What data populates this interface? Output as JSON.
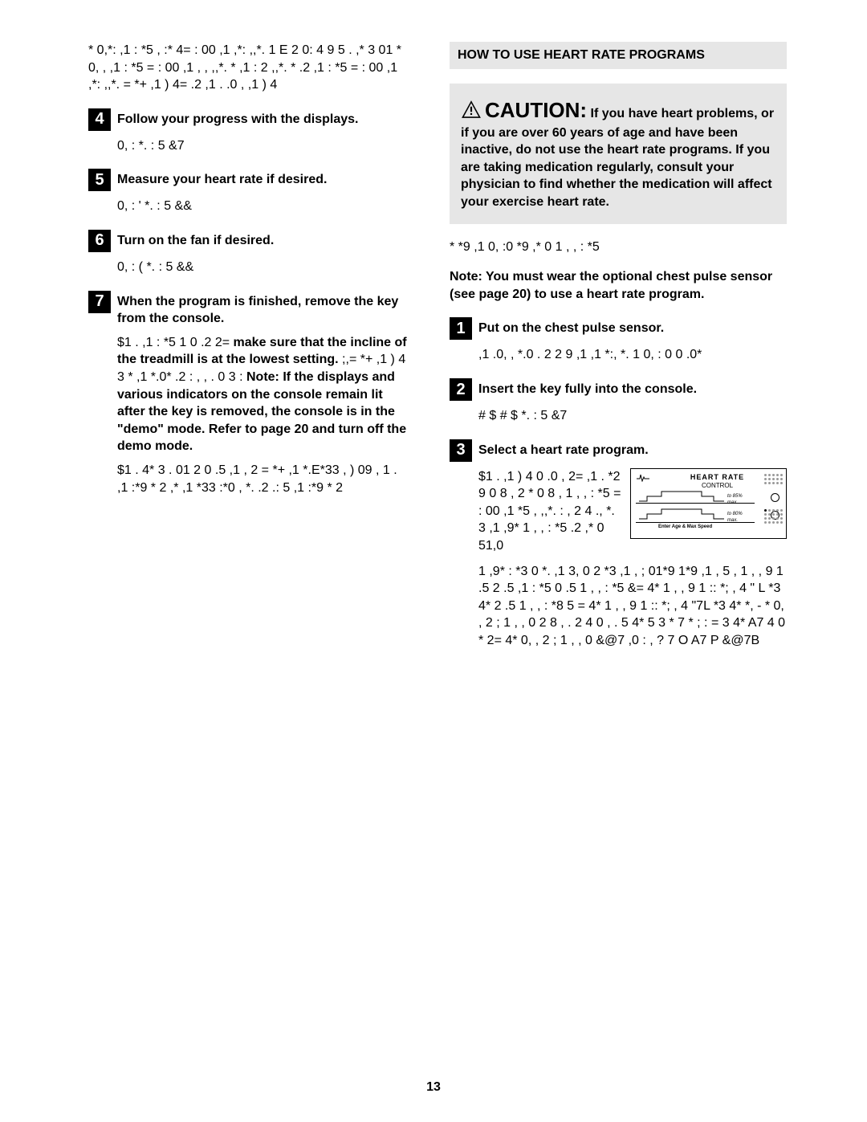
{
  "left": {
    "intro_para": "* 0,*: ,1  : *5    ,  :*    4= :  00 ,1   ,*:  ,,*.   1     E    2 0:  4 9     5 . ,* 3  01 *  0,  , ,1  : *5   = :  00 ,1   ,  ,                 ,,*.  * ,1   :  2         ,,*.  *  .2 ,1  : *5   = :  00 ,1   ,*:  ,,*. =   *+ ,1  ) 4=  .2 ,1 .   .0  , ,1  ) 4",
    "step4_title": "Follow your progress with the displays.",
    "step4_body": "0, :   *. : 5  &7",
    "step5_title": "Measure your heart rate if desired.",
    "step5_body": "0, : ' *. : 5  &&",
    "step6_title": "Turn on the fan if desired.",
    "step6_body": "0, : ( *. : 5  &&",
    "step7_title": "When the program is finished, remove the key from the console.",
    "step7_para1_a": "$1 . ,1  : *5   1 0  .2 2=          ",
    "step7_para1_b": "make sure that the incline of the treadmill is at the lowest setting.",
    "step7_para1_c": "  ;,=    *+  ,1  ) 4 3 *  ,1   *.0*   .2  :  ,   ,   .   0 3  :            ",
    "step7_para1_d": "Note: If the displays and various indicators on the console remain lit after the key is removed, the console is in the \"demo\" mode. Refer to page 20 and turn off the demo mode.",
    "step7_para2": "$1 . 4*    3 . 01 2  0 .5 ,1   ,  2   =  *+ ,1   *.E*33    ,    )  09 , 1 .   ,1  :*9  * 2 ,* ,1   *33 :*0 , *.  .2  .: 5 ,1  :*9   * 2"
  },
  "right": {
    "header": "HOW TO USE HEART RATE PROGRAMS",
    "caution_title": "CAUTION:",
    "caution_body": " If you have heart problems, or if you are over 60 years of age and have been inactive, do not use the heart rate programs. If you are taking medication regularly, consult your physician to find whether the medication will affect your exercise heart rate.",
    "pre_note": "*  *9  ,1  0, :0   *9  ,*  0   1   ,   ,  : *5",
    "note_bold": "Note: You must wear the optional chest pulse sensor (see page 20) to use a heart rate program.",
    "step1_title": "Put on the chest pulse sensor.",
    "step1_body": ",1   .0,   , *.0 .   2 2 9 ,1 ,1  *:, *. 1 0, :  0  0 .0*",
    "step2_title": "Insert the key fully into the console.",
    "step2_body": "   # $        #   $  *. : 5 &7",
    "step3_title": "Select a heart rate program.",
    "step3_body1": "$1 . ,1  ) 4 0  .0 , 2= ,1  .    *2 9      0 8 , 2   *  0 8 ,  1   , ,  : *5   = :  00 ,1   *5       ,  ,,*.  :  ,  2 4  ., *. 3 ,1 ,9* 1   ,   ,  : *5     .2  ,* 0  51,0",
    "step3_body2": "1  ,9* : *3  0 *. ,1    3, 0 2 *3 ,1   ,  ; 01*9 1*9 ,1   , 5 , 1   ,   ,  9    1 .5 2  .5 ,1  : *5  0    .5 1   ,   ,  : *5     &= 4*  1   ,   , 9    1  :: *;   , 4 \" L *3 4*                                   2  .5 1   ,   ,  : *8 5     = 4*  1   ,   , 9    1  :: *;   , 4 \"7L *3 4* *, -  *   0,   , 2   ;    1   ,   ,   0 2 8 ,   .  2  4  0   ,  . 5 4*   5  3 *   7  * ;  :   =   3 4*      A7  4  0  *  2= 4*  0,   , 2 ;    1   ,   ,   0 &@7  ,0 :     ,  ? 7 O A7 P &@7B",
    "hr_diagram": {
      "brand": "HEART RATE",
      "sub": "CONTROL",
      "label1": "to 85% max.",
      "label2": "to 80% max.",
      "bottom": "Enter Age & Max Speed"
    }
  },
  "page_number": "13"
}
